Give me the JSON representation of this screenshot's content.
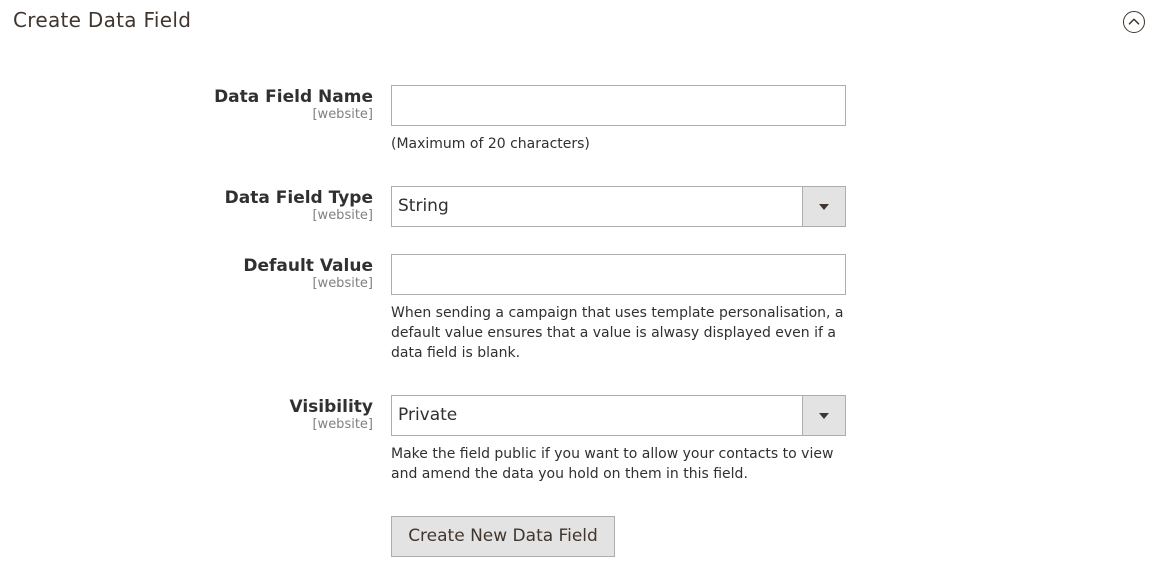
{
  "section": {
    "title": "Create Data Field",
    "toggle_icon": "chevron-up-circle-icon"
  },
  "fields": {
    "name": {
      "label": "Data Field Name",
      "scope": "[website]",
      "value": "",
      "note": "(Maximum of 20 characters)"
    },
    "type": {
      "label": "Data Field Type",
      "scope": "[website]",
      "selected": "String"
    },
    "default": {
      "label": "Default Value",
      "scope": "[website]",
      "value": "",
      "note": "When sending a campaign that uses template personalisation, a default value ensures that a value is alwasy displayed even if a data field is blank."
    },
    "visibility": {
      "label": "Visibility",
      "scope": "[website]",
      "selected": "Private",
      "note": "Make the field public if you want to allow your contacts to view and amend the data you hold on them in this field."
    }
  },
  "actions": {
    "submit_label": "Create New Data Field"
  },
  "colors": {
    "title": "#41362f",
    "text": "#303030",
    "scope": "#808080",
    "border": "#adadad",
    "button_bg": "#e3e3e3"
  }
}
